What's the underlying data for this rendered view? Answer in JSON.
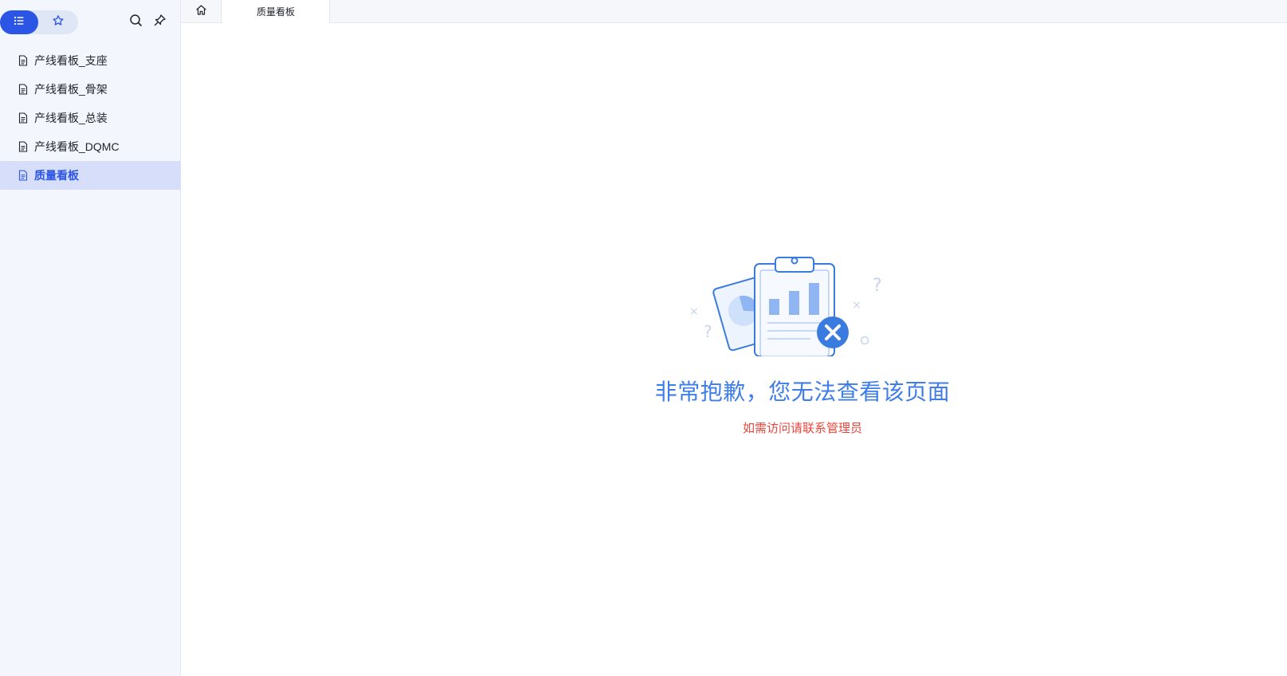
{
  "sidebar": {
    "items": [
      {
        "label": "产线看板_支座"
      },
      {
        "label": "产线看板_骨架"
      },
      {
        "label": "产线看板_总装"
      },
      {
        "label": "产线看板_DQMC"
      },
      {
        "label": "质量看板"
      }
    ],
    "active_index": 4
  },
  "tabs": [
    {
      "label": "质量看板"
    }
  ],
  "error": {
    "title": "非常抱歉，您无法查看该页面",
    "subtitle": "如需访问请联系管理员"
  },
  "colors": {
    "accent": "#2a55e5",
    "title": "#3f7de8",
    "error": "#e8453c",
    "sidebar_bg": "#f3f6fd",
    "active_item_bg": "#d6defa"
  },
  "icons": {
    "view_toggle": "list-icon",
    "favorites": "star-icon",
    "search": "search-icon",
    "pin": "pin-icon",
    "item": "document-icon",
    "home": "home-icon",
    "resize": "drag-handle-icon",
    "illustration": "no-permission-illustration"
  }
}
